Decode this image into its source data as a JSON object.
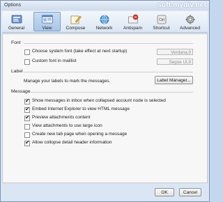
{
  "window": {
    "title": "Options",
    "watermark": "soft.mydiv.net"
  },
  "toolbar": {
    "items": [
      {
        "label": "General",
        "icon": "general-icon"
      },
      {
        "label": "View",
        "icon": "view-icon",
        "active": true
      },
      {
        "label": "Compose",
        "icon": "compose-icon"
      },
      {
        "label": "Network",
        "icon": "network-icon"
      },
      {
        "label": "Antispam",
        "icon": "antispam-icon"
      },
      {
        "label": "Shortcut",
        "icon": "shortcut-icon"
      },
      {
        "label": "Advanced",
        "icon": "advanced-icon"
      }
    ]
  },
  "font_section": {
    "title": "Font",
    "options": [
      {
        "label": "Choose system font (take effect at next startup)",
        "checked": false,
        "value": "Verdana,9"
      },
      {
        "label": "Custom font in maillist",
        "checked": false,
        "value": "Segoe UI,9"
      }
    ]
  },
  "label_section": {
    "title": "Label",
    "description": "Manage your labels to mark the messages.",
    "button": "Label Manager..."
  },
  "message_section": {
    "title": "Message",
    "options": [
      {
        "label": "Show messages in inbox when collapsed account node is selected",
        "checked": true
      },
      {
        "label": "Embed Internet Explorer to view HTML message",
        "checked": true
      },
      {
        "label": "Preview attachments content",
        "checked": true
      },
      {
        "label": "View attachments to use large icon",
        "checked": false
      },
      {
        "label": "Create new tab page when opening a message",
        "checked": false
      },
      {
        "label": "Allow collopse detail header information",
        "checked": true
      }
    ]
  },
  "footer": {
    "ok": "OK",
    "cancel": "Cancel"
  }
}
